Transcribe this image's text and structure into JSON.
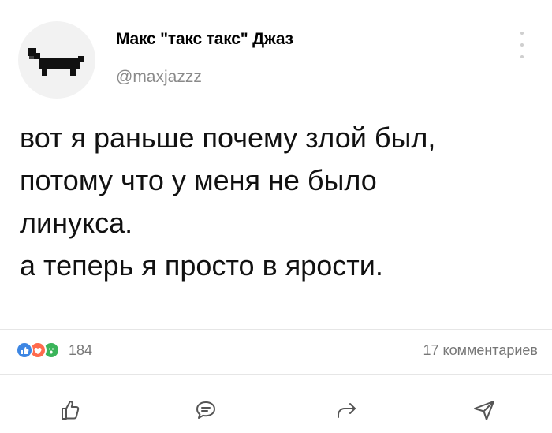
{
  "author": {
    "name": "Макс \"такс такс\" Джаз",
    "handle": "@maxjazzz",
    "avatar_icon": "dachshund-pixel-icon"
  },
  "post": {
    "lines": [
      "вот я раньше почему злой был,",
      "потому что у меня не было",
      "линукса.",
      "а теперь я просто в ярости."
    ]
  },
  "stats": {
    "reaction_icons": [
      "like-reaction-icon",
      "love-reaction-icon",
      "wow-reaction-icon"
    ],
    "reactions_count": "184",
    "comments_label": "17 комментариев"
  },
  "actions": {
    "icons": [
      "thumbs-up-icon",
      "comment-icon",
      "share-icon",
      "send-icon"
    ]
  },
  "colors": {
    "text": "#111111",
    "secondary": "#8a8a8a",
    "divider": "#e6e6e6",
    "icon": "#555555"
  }
}
